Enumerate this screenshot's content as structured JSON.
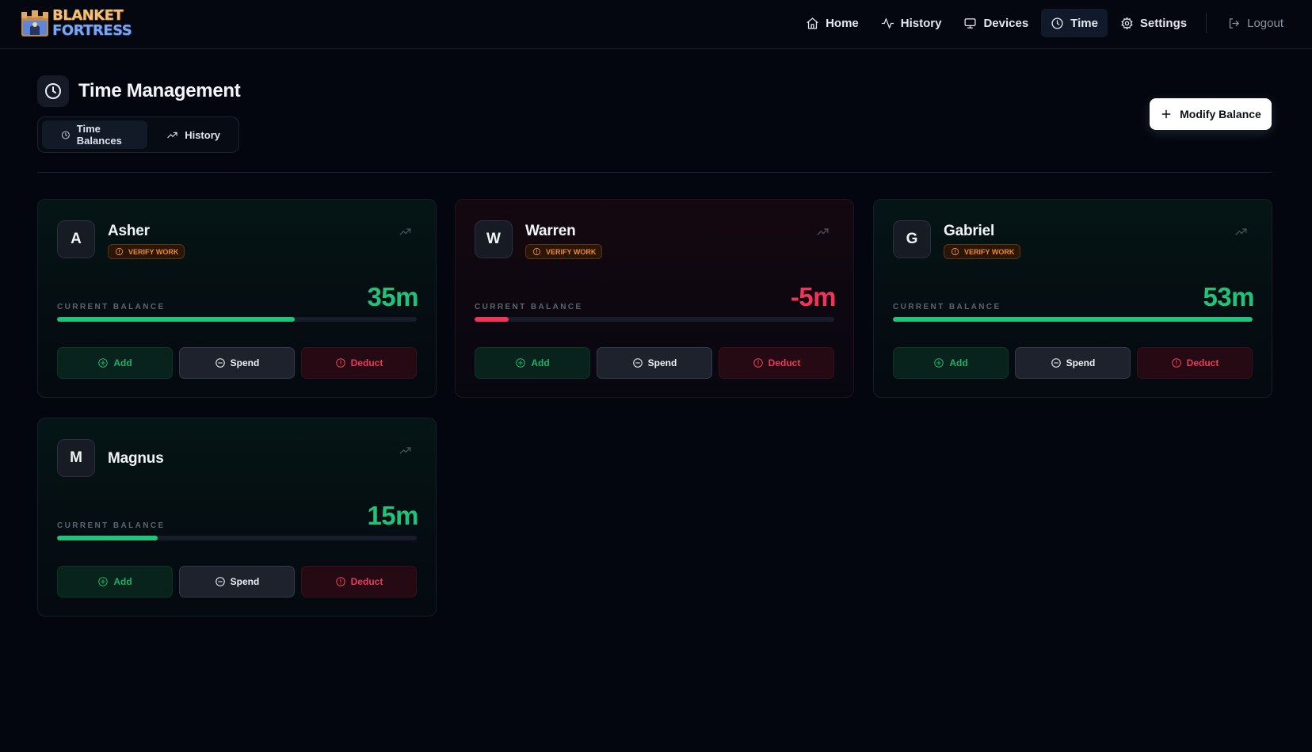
{
  "app": {
    "logo_line1": "BLANKET",
    "logo_line2": "FORTRESS"
  },
  "nav": {
    "items": [
      {
        "label": "Home",
        "icon": "home-icon"
      },
      {
        "label": "History",
        "icon": "activity-icon"
      },
      {
        "label": "Devices",
        "icon": "monitor-icon"
      },
      {
        "label": "Time",
        "icon": "clock-icon",
        "active": true
      },
      {
        "label": "Settings",
        "icon": "gear-icon"
      }
    ],
    "logout": "Logout"
  },
  "page": {
    "title": "Time Management",
    "tabs": [
      {
        "label": "Time Balances",
        "icon": "clock-icon",
        "active": true
      },
      {
        "label": "History",
        "icon": "trending-up-icon"
      }
    ],
    "modify_button": "Modify Balance"
  },
  "labels": {
    "current_balance": "CURRENT BALANCE",
    "verify_work": "VERIFY WORK",
    "add": "Add",
    "spend": "Spend",
    "deduct": "Deduct"
  },
  "colors": {
    "positive": "#1fc47a",
    "negative": "#f2335a",
    "badge": "#f08a2a"
  },
  "users": [
    {
      "initial": "A",
      "name": "Asher",
      "verify": true,
      "balance": "35m",
      "fill_percent": 66,
      "negative": false
    },
    {
      "initial": "W",
      "name": "Warren",
      "verify": true,
      "balance": "-5m",
      "fill_percent": 9.5,
      "negative": true
    },
    {
      "initial": "G",
      "name": "Gabriel",
      "verify": true,
      "balance": "53m",
      "fill_percent": 100,
      "negative": false
    },
    {
      "initial": "M",
      "name": "Magnus",
      "verify": false,
      "balance": "15m",
      "fill_percent": 28,
      "negative": false
    }
  ]
}
